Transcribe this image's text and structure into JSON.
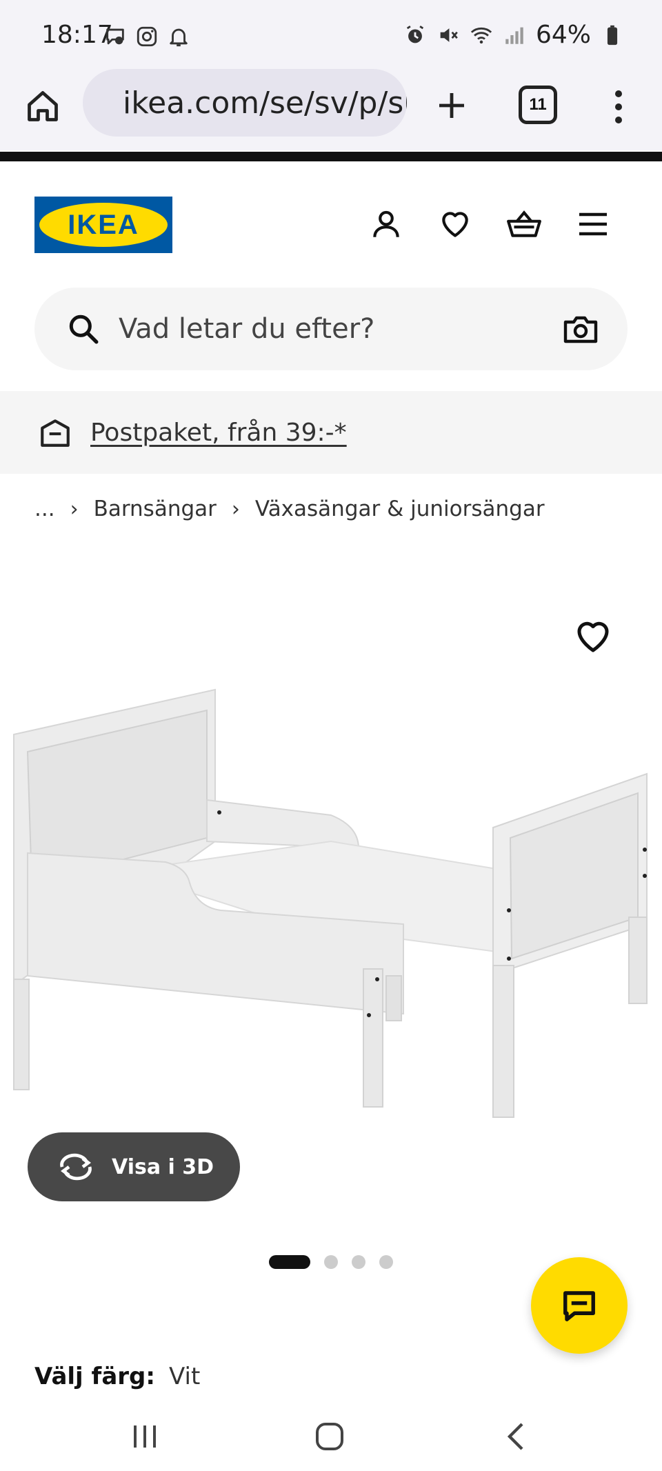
{
  "status_bar": {
    "time": "18:17",
    "battery": "64%",
    "left_icons": [
      "messenger-icon",
      "instagram-icon",
      "bell-icon"
    ],
    "right_icons": [
      "alarm-icon",
      "mute-icon",
      "wifi-icon",
      "signal-icon",
      "battery-icon"
    ]
  },
  "browser": {
    "url": "ikea.com/se/sv/p/su",
    "tab_count": "11"
  },
  "header": {
    "logo_text": "IKEA",
    "icons": [
      "user-icon",
      "heart-icon",
      "basket-icon",
      "menu-icon"
    ]
  },
  "search": {
    "placeholder": "Vad letar du efter?"
  },
  "promo": {
    "text": "Postpaket, från 39:-*"
  },
  "breadcrumb": {
    "ellipsis": "...",
    "items": [
      "Barnsängar",
      "Växasängar & juniorsängar"
    ]
  },
  "product": {
    "view3d_label": "Visa i 3D",
    "carousel": {
      "total": 4,
      "active": 1
    }
  },
  "color": {
    "label": "Välj färg:",
    "value": "Vit"
  },
  "colors": {
    "ikea_blue": "#0058a3",
    "ikea_yellow": "#ffdb00",
    "view3d_bg": "#484848",
    "promo_bg": "#f5f5f5"
  }
}
